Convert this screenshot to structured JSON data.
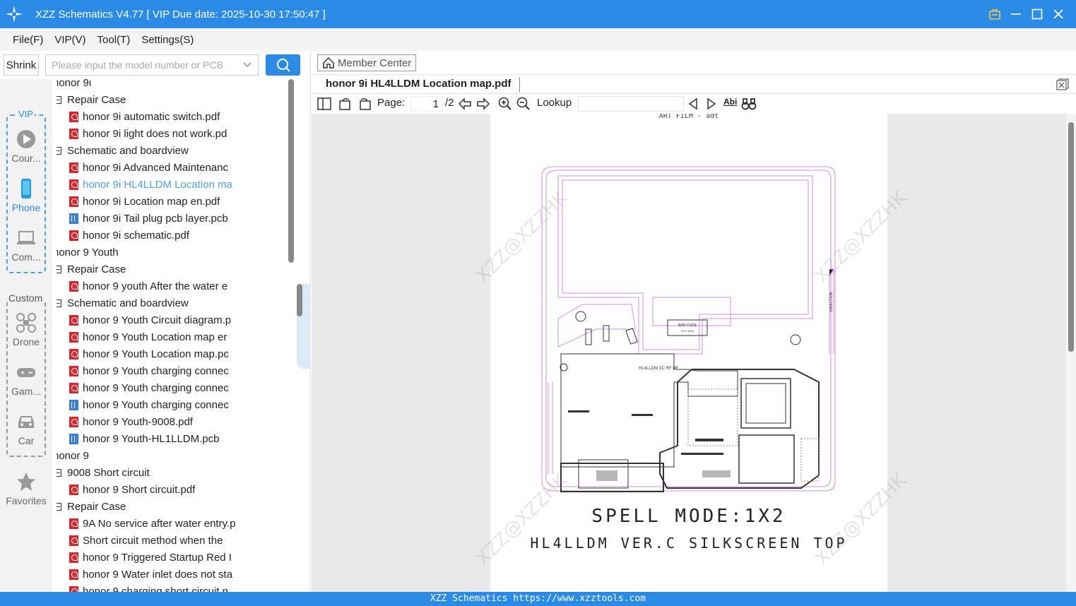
{
  "window": {
    "title": "XZZ Schematics V4.77 [ VIP Due date: 2025-10-30 17:50:47 ]"
  },
  "menu": {
    "file": "File(F)",
    "vip": "VIP(V)",
    "tool": "Tool(T)",
    "settings": "Settings(S)"
  },
  "sidebar": {
    "shrink_label": "Shrink",
    "search_placeholder": "Please input the model number or PCB",
    "vip_label": "VIP",
    "custom_label": "Custom",
    "categories": [
      "Cour...",
      "Phone",
      "Com...",
      "Drone",
      "Gam...",
      "Car",
      "Favorites"
    ]
  },
  "tree": [
    {
      "level": 0,
      "label": "honor 9i",
      "type": "folder"
    },
    {
      "level": 1,
      "label": "Repair Case",
      "type": "folder"
    },
    {
      "level": 2,
      "label": "honor 9i automatic switch.pdf",
      "type": "pdf"
    },
    {
      "level": 2,
      "label": "honor 9i light does not work.pd",
      "type": "pdf"
    },
    {
      "level": 1,
      "label": "Schematic and boardview",
      "type": "folder"
    },
    {
      "level": 2,
      "label": "honor 9i Advanced Maintenanc",
      "type": "pdf"
    },
    {
      "level": 2,
      "label": "honor 9i HL4LLDM Location ma",
      "type": "pdf",
      "selected": true
    },
    {
      "level": 2,
      "label": "honor 9i Location map en.pdf",
      "type": "pdf"
    },
    {
      "level": 2,
      "label": "honor 9i Tail plug pcb layer.pcb",
      "type": "pcb"
    },
    {
      "level": 2,
      "label": "honor 9i schematic.pdf",
      "type": "pdf"
    },
    {
      "level": 0,
      "label": "honor 9 Youth",
      "type": "folder"
    },
    {
      "level": 1,
      "label": "Repair Case",
      "type": "folder"
    },
    {
      "level": 2,
      "label": "honor 9 youth After the water e",
      "type": "pdf"
    },
    {
      "level": 1,
      "label": "Schematic and boardview",
      "type": "folder"
    },
    {
      "level": 2,
      "label": "honor 9 Youth Circuit diagram.p",
      "type": "pdf"
    },
    {
      "level": 2,
      "label": "honor 9 Youth Location map er",
      "type": "pdf"
    },
    {
      "level": 2,
      "label": "honor 9 Youth Location map.pc",
      "type": "pdf"
    },
    {
      "level": 2,
      "label": "honor 9 Youth charging connec",
      "type": "pdf"
    },
    {
      "level": 2,
      "label": "honor 9 Youth charging connec",
      "type": "pdf"
    },
    {
      "level": 2,
      "label": "honor 9 Youth charging connec",
      "type": "pcb"
    },
    {
      "level": 2,
      "label": "honor 9 Youth-9008.pdf",
      "type": "pdf"
    },
    {
      "level": 2,
      "label": "honor 9 Youth-HL1LLDM.pcb",
      "type": "pcb"
    },
    {
      "level": 0,
      "label": "honor 9",
      "type": "folder"
    },
    {
      "level": 1,
      "label": "9008 Short circuit",
      "type": "folder"
    },
    {
      "level": 2,
      "label": "honor 9 Short circuit.pdf",
      "type": "pdf"
    },
    {
      "level": 1,
      "label": "Repair Case",
      "type": "folder"
    },
    {
      "level": 2,
      "label": "9A No service after water entry.p",
      "type": "pdf"
    },
    {
      "level": 2,
      "label": "Short circuit method when the",
      "type": "pdf"
    },
    {
      "level": 2,
      "label": "honor 9 Triggered Startup Red I",
      "type": "pdf"
    },
    {
      "level": 2,
      "label": "honor 9 Water inlet does not sta",
      "type": "pdf"
    },
    {
      "level": 2,
      "label": "honor 9 charging short circuit n",
      "type": "pdf"
    }
  ],
  "viewer": {
    "member_center": "Member Center",
    "tab_title": "honor 9i HL4LLDM Location map.pdf",
    "page_label": "Page:",
    "page_current": "1",
    "page_total": "/2",
    "lookup_label": "Lookup",
    "abi_label": "Abi"
  },
  "document": {
    "header": "ART FILM - adt",
    "line1": "SPELL MODE:1X2",
    "line2": "HL4LLDM VER.C SILKSCREEN TOP",
    "board_label": "HL4LLDM VC RF HF",
    "barcode": "BAR CODE",
    "barcode_size": "10 X 4mm",
    "direction": "DIRECTION",
    "watermark": "XZZ@XZZHK"
  },
  "footer": {
    "text": "XZZ Schematics https://www.xzztools.com"
  },
  "colors": {
    "accent": "#2a8be6",
    "pdf_red": "#d9262c",
    "outline": "#d28ee0"
  }
}
